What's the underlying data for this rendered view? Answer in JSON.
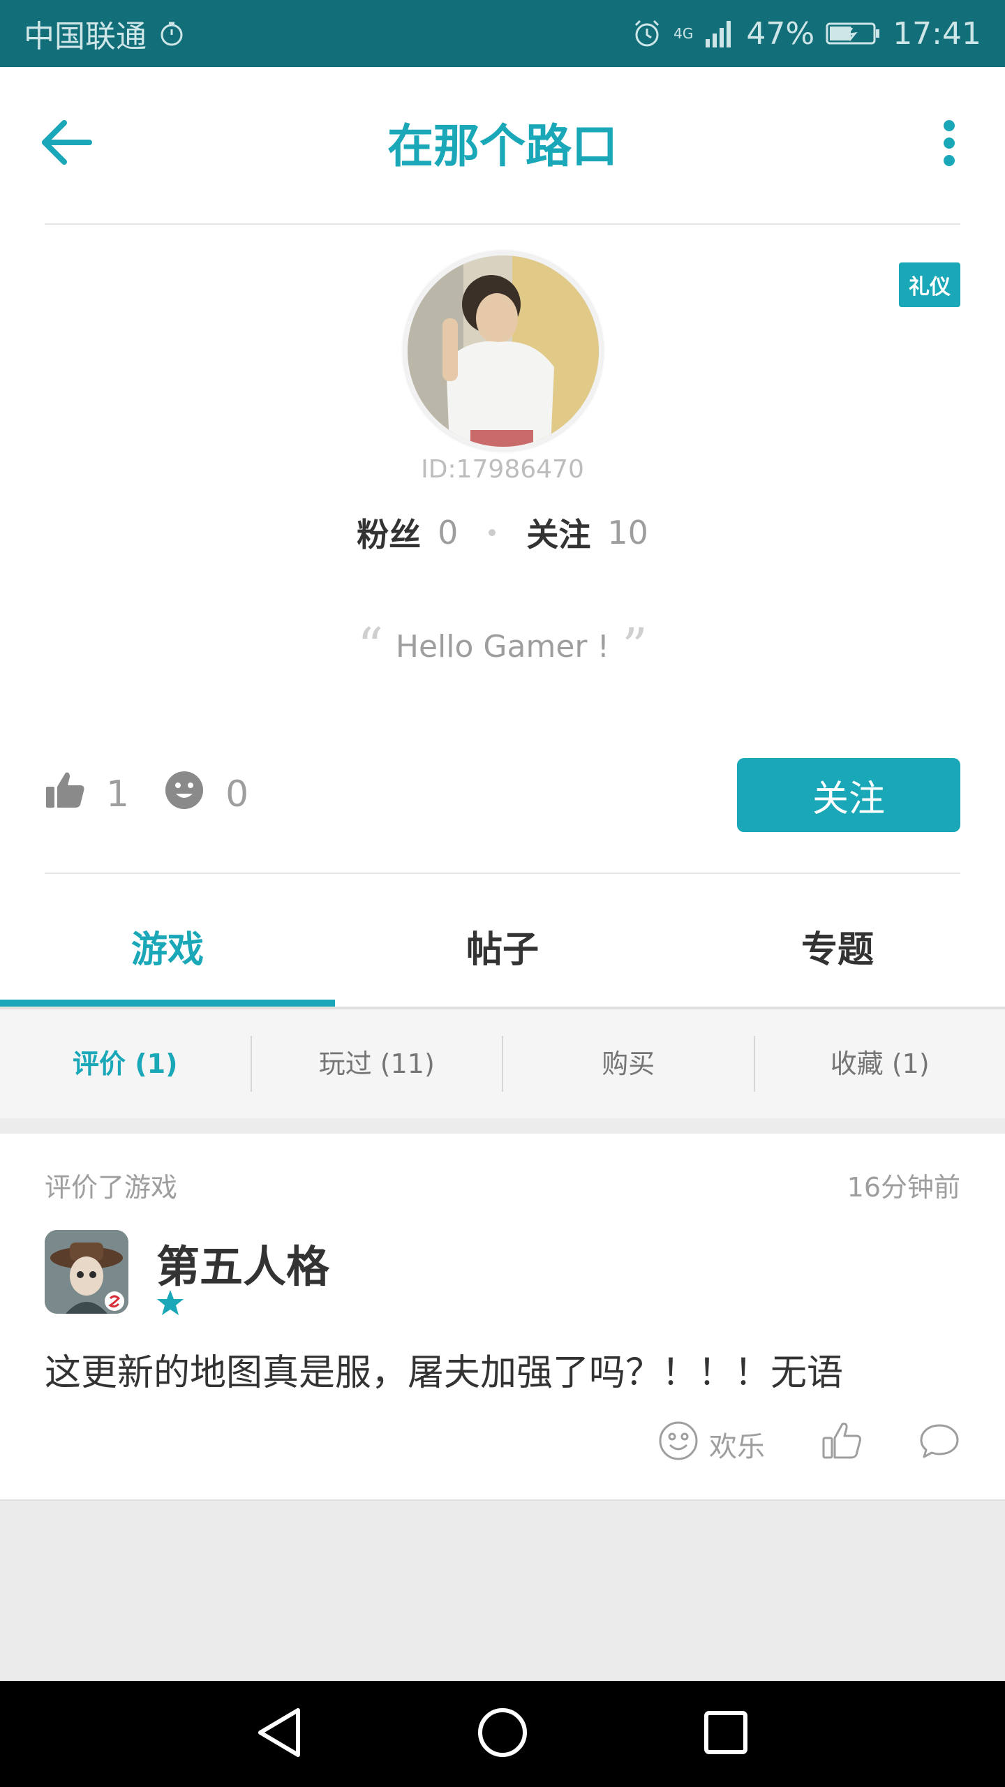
{
  "status_bar": {
    "carrier": "中国联通",
    "network": "4G",
    "battery": "47%",
    "time": "17:41"
  },
  "header": {
    "title": "在那个路口"
  },
  "profile": {
    "badge": "礼仪",
    "user_id": "ID:17986470",
    "fans_label": "粉丝",
    "fans_count": "0",
    "following_label": "关注",
    "following_count": "10",
    "bio": "Hello Gamer !",
    "likes": "1",
    "happy_count": "0",
    "follow_button": "关注"
  },
  "tabs": [
    {
      "label": "游戏",
      "active": true
    },
    {
      "label": "帖子",
      "active": false
    },
    {
      "label": "专题",
      "active": false
    }
  ],
  "subtabs": [
    {
      "label": "评价 (1)",
      "active": true
    },
    {
      "label": "玩过 (11)",
      "active": false
    },
    {
      "label": "购买",
      "active": false
    },
    {
      "label": "收藏 (1)",
      "active": false
    }
  ],
  "review": {
    "action": "评价了游戏",
    "time": "16分钟前",
    "game_name": "第五人格",
    "rating": 1,
    "text": "这更新的地图真是服，屠夫加强了吗？！！！无语",
    "reaction_label": "欢乐"
  },
  "colors": {
    "accent": "#1aa8b8",
    "status_bar": "#126e78"
  }
}
